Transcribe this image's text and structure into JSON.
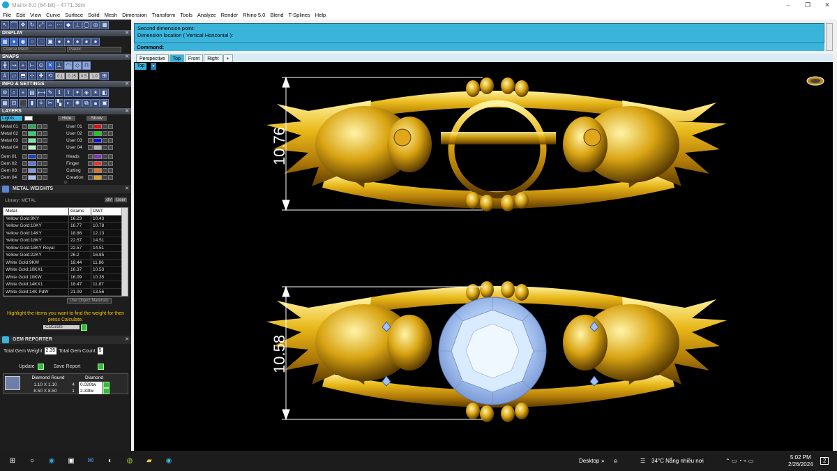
{
  "window": {
    "title": "Matrix 8.0 (64-bit) - 4771.3dm",
    "min": "–",
    "max": "❐",
    "close": "✕"
  },
  "menu": [
    "File",
    "Edit",
    "View",
    "Curve",
    "Surface",
    "Solid",
    "Mesh",
    "Dimension",
    "Transform",
    "Tools",
    "Analyze",
    "Render",
    "Rhino 5.0",
    "Blend",
    "T-Splines",
    "Help"
  ],
  "panels": {
    "display": {
      "title": "DISPLAY",
      "mesh_select": "Coarse Mesh",
      "material_select": "Plastic"
    },
    "snaps": {
      "title": "SNAPS",
      "values": [
        "0.1",
        "0.25",
        "0.5",
        "1.0"
      ]
    },
    "info": {
      "title": "INFO & SETTINGS"
    },
    "layers": {
      "title": "LAYERS",
      "lights": "Lights",
      "hide": "Hide",
      "show": "Show",
      "left": [
        {
          "name": "Metal 01",
          "color": "#22aa55"
        },
        {
          "name": "Metal 02",
          "color": "#2bd46b"
        },
        {
          "name": "Metal 03",
          "color": "#74e897"
        },
        {
          "name": "Metal 04",
          "color": "#b8f5c8"
        },
        {
          "name": "Gem 01",
          "color": "#1a3fc0"
        },
        {
          "name": "Gem 02",
          "color": "#5b78d8"
        },
        {
          "name": "Gem 03",
          "color": "#7d9ae6"
        },
        {
          "name": "Gem 04",
          "color": "#a9bdf0"
        }
      ],
      "right": [
        {
          "name": "User 01",
          "color": "#e01010"
        },
        {
          "name": "User 02",
          "color": "#10d010"
        },
        {
          "name": "User 03",
          "color": "#1010e0"
        },
        {
          "name": "User 04",
          "color": "#b0b0b0"
        },
        {
          "name": "Heads",
          "color": "#8a2ec0"
        },
        {
          "name": "Finger",
          "color": "#e03838"
        },
        {
          "name": "Cutting",
          "color": "#e07020"
        },
        {
          "name": "Creation",
          "color": "#e0a020"
        }
      ]
    },
    "metal_weights": {
      "title": "METAL WEIGHTS",
      "library": "Library: METAL",
      "btn_dv": "dV",
      "btn_user": "User",
      "headers": [
        "Metal",
        "Grams",
        "DWT"
      ],
      "rows": [
        [
          "Yellow Gold:9KY",
          "16.23",
          "10.43"
        ],
        [
          "Yellow Gold:10KY",
          "16.77",
          "10.78"
        ],
        [
          "Yellow Gold:14KY",
          "18.86",
          "12.13"
        ],
        [
          "Yellow Gold:18KY",
          "22.57",
          "14.51"
        ],
        [
          "Yellow Gold:18KY Royal",
          "22.57",
          "14.51"
        ],
        [
          "Yellow Gold:22KY",
          "26.2",
          "16.85"
        ],
        [
          "White Gold:9KW",
          "18.44",
          "11.86"
        ],
        [
          "White Gold:10KX1",
          "16.37",
          "10.53"
        ],
        [
          "White Gold:10KW",
          "16.09",
          "10.35"
        ],
        [
          "White Gold:14KX1",
          "18.47",
          "11.87"
        ],
        [
          "White Gold:14K PdW",
          "21.09",
          "13.56"
        ]
      ],
      "use_materials": "Use Object Materials",
      "hint": "Highlight the items you want to find the weight for then press Calculate.",
      "calculate": "Calculate"
    },
    "gem_reporter": {
      "title": "GEM REPORTER",
      "total_weight_label": "Total Gem Weight",
      "total_weight": "2.35",
      "total_count_label": "Total Gem Count",
      "total_count": "5",
      "update": "Update",
      "save": "Save Report",
      "headers": [
        "Diamond Round",
        "Diamond"
      ],
      "rows": [
        [
          "1.10 X 1.10",
          "4",
          "0.020tw"
        ],
        [
          "8.50 X 8.50",
          "1",
          "2.33tw"
        ]
      ]
    }
  },
  "command": {
    "line1": "Second dimension point:",
    "line2": "Dimension location ( Vertical  Horizontal ):",
    "prompt": "Command:"
  },
  "tabs": [
    "Perspective",
    "Top",
    "Front",
    "Right",
    "+"
  ],
  "active_tab": "Top",
  "viewport": {
    "label": "Top",
    "dim_top": "10.76",
    "dim_bottom": "10.58"
  },
  "taskbar": {
    "desktop": "Desktop",
    "weather": "34°C  Nắng nhiều nơi",
    "time": "5:02 PM",
    "date": "2/26/2024",
    "notif": "2"
  }
}
